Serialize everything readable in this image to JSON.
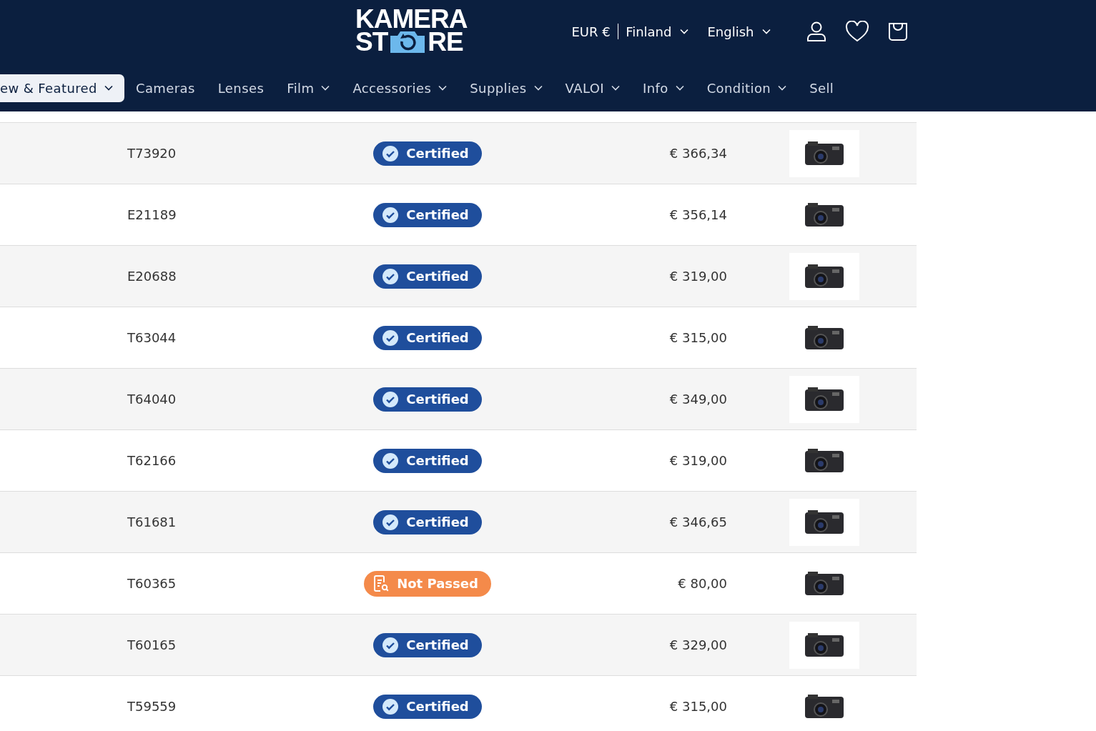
{
  "header": {
    "logo": {
      "line_1": "KAMERA",
      "line_2_start": "ST",
      "line_2_end": "RE"
    },
    "currency": "EUR €",
    "country": "Finland",
    "language": "English"
  },
  "nav": [
    {
      "label": "ew & Featured",
      "dropdown": true,
      "selected": true
    },
    {
      "label": "Cameras",
      "dropdown": false,
      "selected": false
    },
    {
      "label": "Lenses",
      "dropdown": false,
      "selected": false
    },
    {
      "label": "Film",
      "dropdown": true,
      "selected": false
    },
    {
      "label": "Accessories",
      "dropdown": true,
      "selected": false
    },
    {
      "label": "Supplies",
      "dropdown": true,
      "selected": false
    },
    {
      "label": "VALOI",
      "dropdown": true,
      "selected": false
    },
    {
      "label": "Info",
      "dropdown": true,
      "selected": false
    },
    {
      "label": "Condition",
      "dropdown": true,
      "selected": false
    },
    {
      "label": "Sell",
      "dropdown": false,
      "selected": false
    }
  ],
  "table": {
    "rows": [
      {
        "sku": "T73920",
        "status": {
          "kind": "certified",
          "label": "Certified"
        },
        "price": "€ 366,34"
      },
      {
        "sku": "E21189",
        "status": {
          "kind": "certified",
          "label": "Certified"
        },
        "price": "€ 356,14"
      },
      {
        "sku": "E20688",
        "status": {
          "kind": "certified",
          "label": "Certified"
        },
        "price": "€ 319,00"
      },
      {
        "sku": "T63044",
        "status": {
          "kind": "certified",
          "label": "Certified"
        },
        "price": "€ 315,00"
      },
      {
        "sku": "T64040",
        "status": {
          "kind": "certified",
          "label": "Certified"
        },
        "price": "€ 349,00"
      },
      {
        "sku": "T62166",
        "status": {
          "kind": "certified",
          "label": "Certified"
        },
        "price": "€ 319,00"
      },
      {
        "sku": "T61681",
        "status": {
          "kind": "certified",
          "label": "Certified"
        },
        "price": "€ 346,65"
      },
      {
        "sku": "T60365",
        "status": {
          "kind": "not_passed",
          "label": "Not Passed"
        },
        "price": "€ 80,00"
      },
      {
        "sku": "T60165",
        "status": {
          "kind": "certified",
          "label": "Certified"
        },
        "price": "€ 329,00"
      },
      {
        "sku": "T59559",
        "status": {
          "kind": "certified",
          "label": "Certified"
        },
        "price": "€ 315,00"
      }
    ]
  }
}
